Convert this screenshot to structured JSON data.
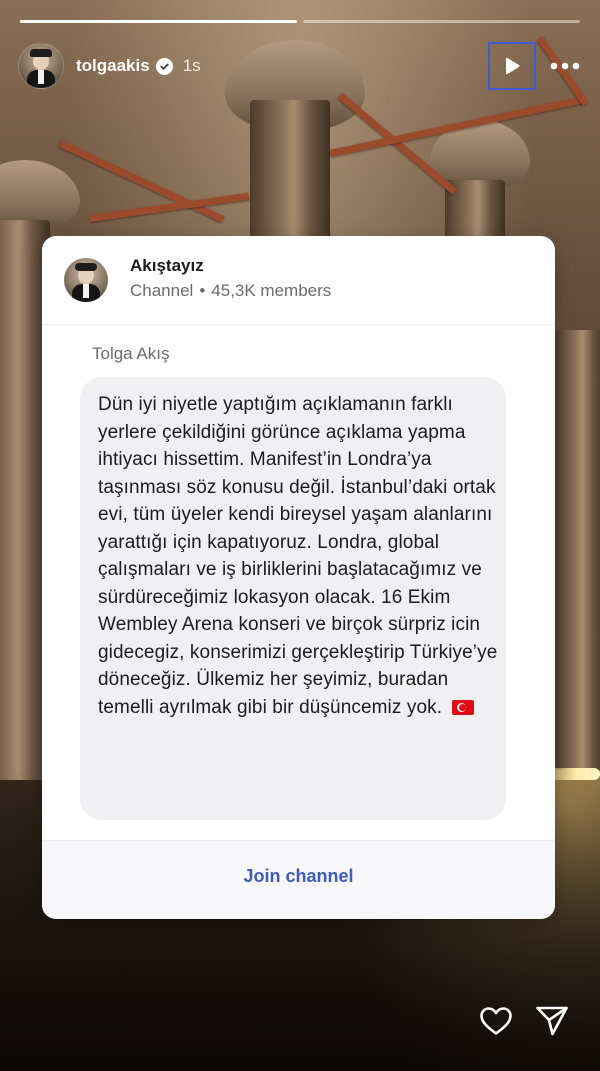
{
  "story": {
    "progress": [
      1.0,
      0.0
    ]
  },
  "header": {
    "username": "tolgaakis",
    "time": "1s",
    "verified_icon": "verified-badge-icon",
    "play_icon": "play-icon",
    "more_icon": "more-dots-icon"
  },
  "card": {
    "channel_name": "Akıştayız",
    "channel_type": "Channel",
    "separator": "•",
    "members": "45,3K members",
    "sender": "Tolga Akış",
    "message": "Dün iyi niyetle yaptığım açıklamanın farklı yerlere çekildiğini görünce açıklama yapma ihtiyacı hissettim. Manifest’in Londra’ya taşınması söz konusu değil. İstanbul’daki ortak evi, tüm üyeler kendi bireysel yaşam alanlarını yarattığı için kapatıyoruz. Londra, global çalışmaları ve iş birliklerini başlatacağımız ve sürdüreceğimiz lokasyon olacak. 16 Ekim Wembley Arena konseri ve birçok sürpriz icin gidecegiz, konserimizi gerçekleştirip Türkiye’ye döneceğiz. Ülkemiz her şeyimiz, buradan temelli ayrılmak gibi bir düşüncemiz yok.",
    "flag_icon": "turkey-flag-icon",
    "join_label": "Join channel"
  },
  "footer": {
    "like_icon": "heart-icon",
    "share_icon": "send-icon"
  },
  "colors": {
    "accent": "#3e5bb8",
    "focus_outline": "#3d5bd3"
  }
}
